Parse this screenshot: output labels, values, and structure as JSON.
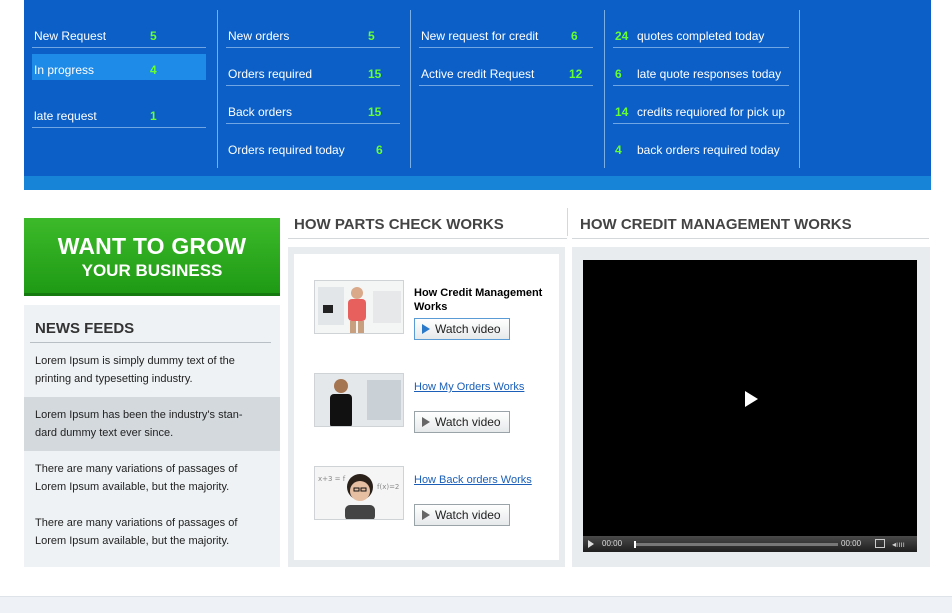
{
  "stats": {
    "col1": [
      {
        "label": "New Request",
        "value": "5"
      },
      {
        "label": "In progress",
        "value": "4"
      },
      {
        "label": "late request",
        "value": "1"
      }
    ],
    "col2": [
      {
        "label": "New orders",
        "value": "5"
      },
      {
        "label": "Orders required",
        "value": "15"
      },
      {
        "label": "Back orders",
        "value": "15"
      },
      {
        "label": "Orders required today",
        "value": "6"
      }
    ],
    "col3": [
      {
        "label": "New request for credit",
        "value": "6"
      },
      {
        "label": "Active credit Request",
        "value": "12"
      }
    ],
    "col4": [
      {
        "value": "24",
        "label": "quotes completed today"
      },
      {
        "value": "6",
        "label": "late quote responses today"
      },
      {
        "value": "14",
        "label": "credits requiored for pick up"
      },
      {
        "value": "4",
        "label": "back orders required today"
      }
    ]
  },
  "banner": {
    "line1": "WANT TO GROW",
    "line2": "YOUR BUSINESS"
  },
  "news": {
    "title": "NEWS FEEDS",
    "items": [
      "Lorem Ipsum is simply dummy text of the printing and typesetting industry.",
      "Lorem Ipsum has been the industry's stan-dard dummy text ever since.",
      "There are many variations of passages of Lorem Ipsum available, but the majority.",
      "There are many variations of passages of Lorem Ipsum available, but the majority."
    ]
  },
  "parts": {
    "title": "HOW PARTS CHECK WORKS",
    "videos": [
      {
        "title": "How Credit Management Works",
        "button": "Watch video"
      },
      {
        "title": "How My Orders Works",
        "button": "Watch video"
      },
      {
        "title": "How Back orders Works",
        "button": "Watch video"
      }
    ]
  },
  "credit": {
    "title": "HOW CREDIT MANAGEMENT WORKS",
    "player": {
      "current_time": "00:00",
      "duration": "00:00"
    }
  },
  "colors": {
    "panel_blue": "#0b5fc6",
    "value_green": "#66ff33",
    "banner_green": "#2aa81e"
  }
}
